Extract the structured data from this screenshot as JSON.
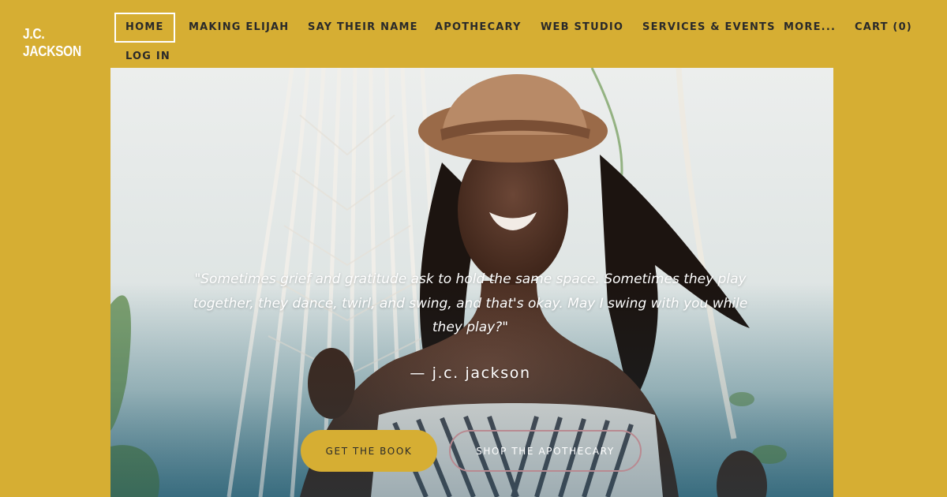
{
  "logo": {
    "line1": "J.C.",
    "line2": "JACKSON"
  },
  "nav": {
    "items": [
      {
        "label": "HOME"
      },
      {
        "label": "MAKING ELIJAH"
      },
      {
        "label": "SAY THEIR NAME"
      },
      {
        "label": "APOTHECARY"
      },
      {
        "label": "WEB STUDIO"
      },
      {
        "label": "SERVICES & EVENTS"
      },
      {
        "label": "MORE..."
      },
      {
        "label": "CART (0)"
      },
      {
        "label": "LOG IN"
      }
    ],
    "active": "HOME"
  },
  "hero": {
    "quote_line1": "\"Sometimes grief and gratitude ask to hold the same space. Sometimes they play",
    "quote_line2": "together, they dance, twirl, and swing, and that's okay. May I swing with you while",
    "quote_line3": "they play?\"",
    "attribution": "— j.c. jackson",
    "primary_button": "GET THE BOOK",
    "secondary_button": "SHOP THE APOTHECARY"
  },
  "colors": {
    "background": "#d6ae33",
    "nav_text": "#2a2a2a",
    "white": "#ffffff",
    "button_outline": "#b98a91"
  }
}
